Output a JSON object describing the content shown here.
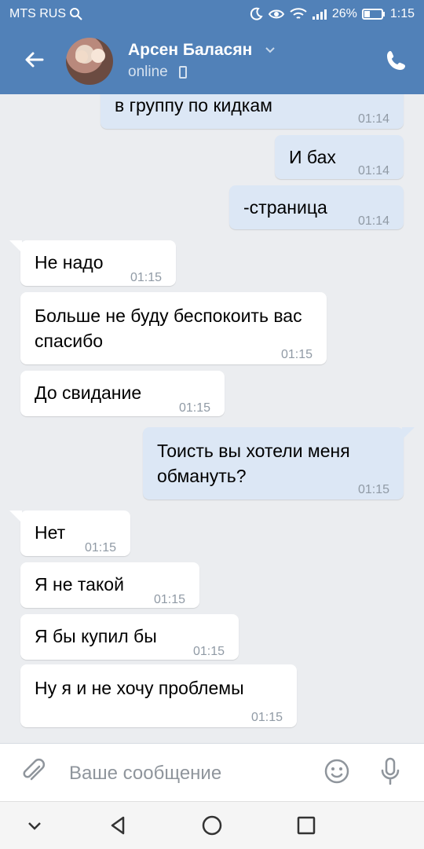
{
  "status_bar": {
    "carrier": "MTS RUS",
    "battery": "26%",
    "time": "1:15"
  },
  "header": {
    "contact_name": "Арсен Баласян",
    "presence": "online"
  },
  "messages": [
    {
      "direction": "out",
      "text": "в группу по кидкам",
      "time": "01:14"
    },
    {
      "direction": "out",
      "text": "И бах",
      "time": "01:14"
    },
    {
      "direction": "out",
      "text": "-страница",
      "time": "01:14"
    },
    {
      "direction": "in",
      "text": "Не надо",
      "time": "01:15"
    },
    {
      "direction": "in",
      "text": "Больше не буду беспокоить вас спасибо",
      "time": "01:15"
    },
    {
      "direction": "in",
      "text": "До свидание",
      "time": "01:15"
    },
    {
      "direction": "out",
      "text": "Тоисть вы хотели меня обмануть?",
      "time": "01:15"
    },
    {
      "direction": "in",
      "text": "Нет",
      "time": "01:15"
    },
    {
      "direction": "in",
      "text": "Я не такой",
      "time": "01:15"
    },
    {
      "direction": "in",
      "text": "Я бы купил бы",
      "time": "01:15"
    },
    {
      "direction": "in",
      "text": "Ну я и не хочу проблемы",
      "time": "01:15"
    }
  ],
  "composer": {
    "placeholder": "Ваше сообщение"
  },
  "icons": {
    "back": "arrow-left-icon",
    "call": "phone-icon",
    "attach": "paperclip-icon",
    "emoji": "smile-icon",
    "mic": "microphone-icon"
  },
  "colors": {
    "header": "#5181b8",
    "outgoing_bubble": "#dce7f5",
    "incoming_bubble": "#ffffff",
    "background": "#ebedf0"
  }
}
